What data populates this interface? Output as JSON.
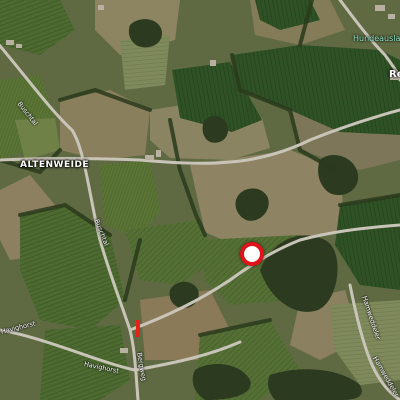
{
  "map": {
    "view": "satellite",
    "labels": {
      "altenweide": "ALTENWEIDE",
      "hundeauslauf": "Hundeauslauf",
      "town_partial": "Re",
      "street_buschtal_upper": "Buschtal",
      "street_buschtal_lower": "Buschtal",
      "street_havighorst_left": "Havighorst",
      "street_havighorst_lower": "Havighorst",
      "street_bergweg": "Bergweg",
      "street_right_1": "Hamweddeler",
      "street_right_2": "Hamweddeler"
    },
    "marker": {
      "color": "#e0131a",
      "fill": "#ffffff",
      "icon": "location-pin-icon"
    },
    "colors": {
      "road": "#c9c4b8",
      "field_dark": "#2c4a1f",
      "field_green": "#4f6a32",
      "field_tan": "#8a7f5c"
    }
  }
}
